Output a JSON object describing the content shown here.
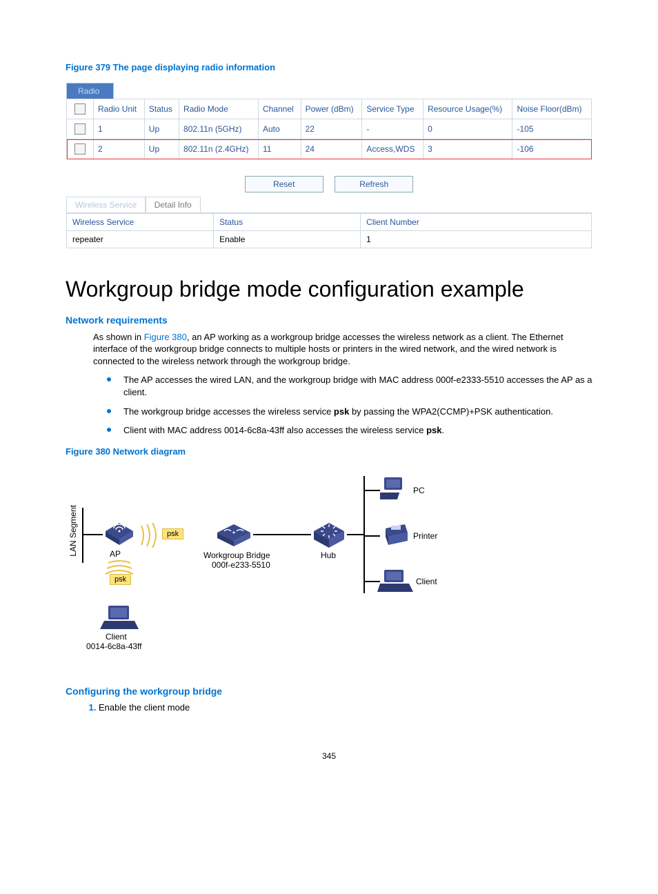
{
  "figure379_title": "Figure 379 The page displaying radio information",
  "radio_tab_label": "Radio",
  "radio_table": {
    "headers": {
      "unit": "Radio Unit",
      "status": "Status",
      "mode": "Radio Mode",
      "channel": "Channel",
      "power": "Power (dBm)",
      "service": "Service Type",
      "usage": "Resource Usage(%)",
      "noise": "Noise Floor(dBm)"
    },
    "rows": [
      {
        "unit": "1",
        "status": "Up",
        "mode": "802.11n (5GHz)",
        "channel": "Auto",
        "power": "22",
        "service": "-",
        "usage": "0",
        "noise": "-105"
      },
      {
        "unit": "2",
        "status": "Up",
        "mode": "802.11n (2.4GHz)",
        "channel": "11",
        "power": "24",
        "service": "Access,WDS",
        "usage": "3",
        "noise": "-106"
      }
    ]
  },
  "buttons": {
    "reset": "Reset",
    "refresh": "Refresh"
  },
  "subtabs": {
    "wireless_service": "Wireless Service",
    "detail_info": "Detail Info"
  },
  "ws_table": {
    "headers": {
      "service": "Wireless Service",
      "status": "Status",
      "client": "Client Number"
    },
    "rows": [
      {
        "service": "repeater",
        "status": "Enable",
        "client": "1"
      }
    ]
  },
  "main_heading": "Workgroup bridge mode configuration example",
  "network_requirements_title": "Network requirements",
  "intro_paragraph_pre": "As shown in ",
  "intro_paragraph_link": "Figure 380",
  "intro_paragraph_post": ", an AP working as a workgroup bridge accesses the wireless network as a client. The Ethernet interface of the workgroup bridge connects to multiple hosts or printers in the wired network, and the wired network is connected to the wireless network through the workgroup bridge.",
  "bullets": [
    {
      "text": "The AP accesses the wired LAN, and the workgroup bridge with MAC address 000f-e2333-5510 accesses the AP as a client."
    },
    {
      "pre": "The workgroup bridge accesses the wireless service ",
      "bold": "psk",
      "post": " by passing the WPA2(CCMP)+PSK authentication."
    },
    {
      "pre": "Client with MAC address 0014-6c8a-43ff also accesses the wireless service ",
      "bold": "psk",
      "post": "."
    }
  ],
  "figure380_title": "Figure 380 Network diagram",
  "diagram": {
    "lan_segment": "LAN Segment",
    "ap": "AP",
    "client_mac_label": "Client\n0014-6c8a-43ff",
    "client_label": "Client",
    "workgroup_bridge_label": "Workgroup Bridge\n000f-e233-5510",
    "wb_line1": "Workgroup Bridge",
    "wb_line2": "000f-e233-5510",
    "hub": "Hub",
    "pc": "PC",
    "printer": "Printer",
    "psk": "psk"
  },
  "configuring_title": "Configuring the workgroup bridge",
  "step1": "Enable the client mode",
  "page_number": "345"
}
